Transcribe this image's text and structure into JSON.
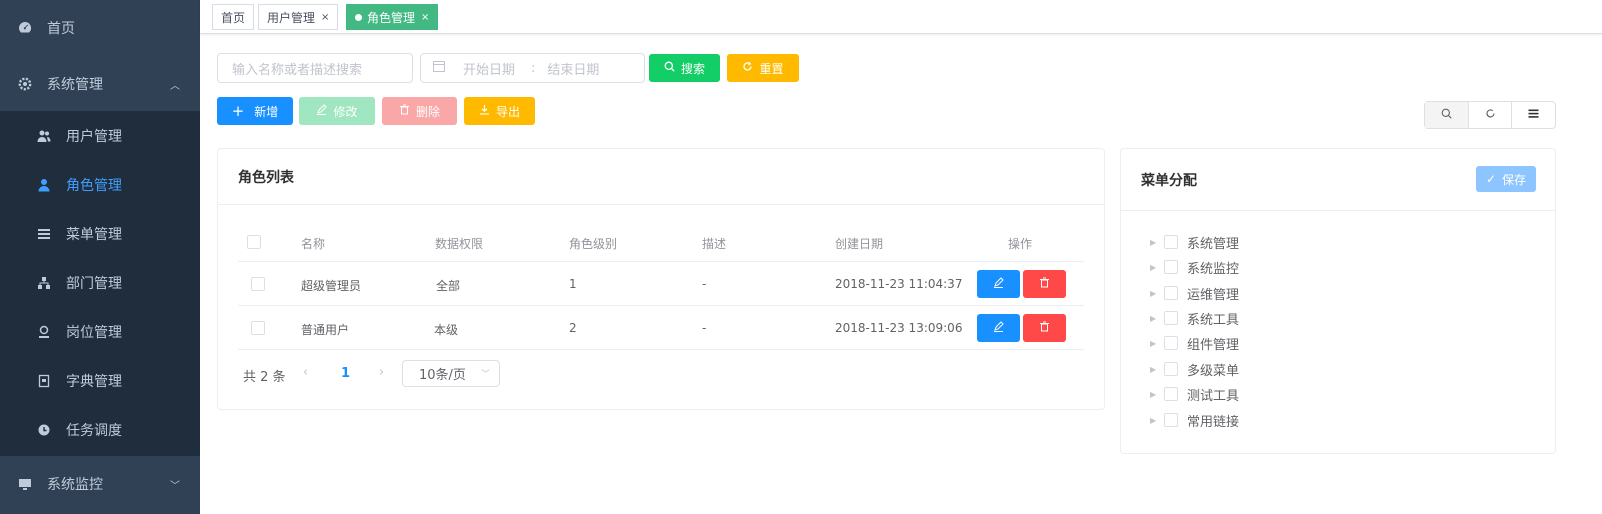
{
  "sidebar": {
    "home": "首页",
    "system": "系统管理",
    "items": [
      {
        "label": "用户管理",
        "icon": "users-icon"
      },
      {
        "label": "角色管理",
        "icon": "role-icon"
      },
      {
        "label": "菜单管理",
        "icon": "menu-icon"
      },
      {
        "label": "部门管理",
        "icon": "dept-icon"
      },
      {
        "label": "岗位管理",
        "icon": "post-icon"
      },
      {
        "label": "字典管理",
        "icon": "dict-icon"
      },
      {
        "label": "任务调度",
        "icon": "timer-icon"
      }
    ],
    "monitor": "系统监控",
    "active_color": "#409eff"
  },
  "tags": {
    "home": "首页",
    "user": "用户管理",
    "role": "角色管理",
    "close": "×"
  },
  "search": {
    "placeholder": "输入名称或者描述搜索",
    "start_placeholder": "开始日期",
    "separator": ":",
    "end_placeholder": "结束日期",
    "search_label": "搜索",
    "reset_label": "重置"
  },
  "toolbar": {
    "add": "新增",
    "edit": "修改",
    "delete": "删除",
    "export": "导出"
  },
  "roles_card": {
    "title": "角色列表",
    "columns": [
      "名称",
      "数据权限",
      "角色级别",
      "描述",
      "创建日期",
      "操作"
    ],
    "rows": [
      {
        "name": "超级管理员",
        "scope": "全部",
        "level": "1",
        "desc": "-",
        "created": "2018-11-23 11:04:37"
      },
      {
        "name": "普通用户",
        "scope": "本级",
        "level": "2",
        "desc": "-",
        "created": "2018-11-23 13:09:06"
      }
    ],
    "pagination": {
      "total": "共 2 条",
      "current": "1",
      "page_size": "10条/页"
    }
  },
  "menu_card": {
    "title": "菜单分配",
    "save": "保存",
    "tree": [
      "系统管理",
      "系统监控",
      "运维管理",
      "系统工具",
      "组件管理",
      "多级菜单",
      "测试工具",
      "常用链接"
    ]
  }
}
